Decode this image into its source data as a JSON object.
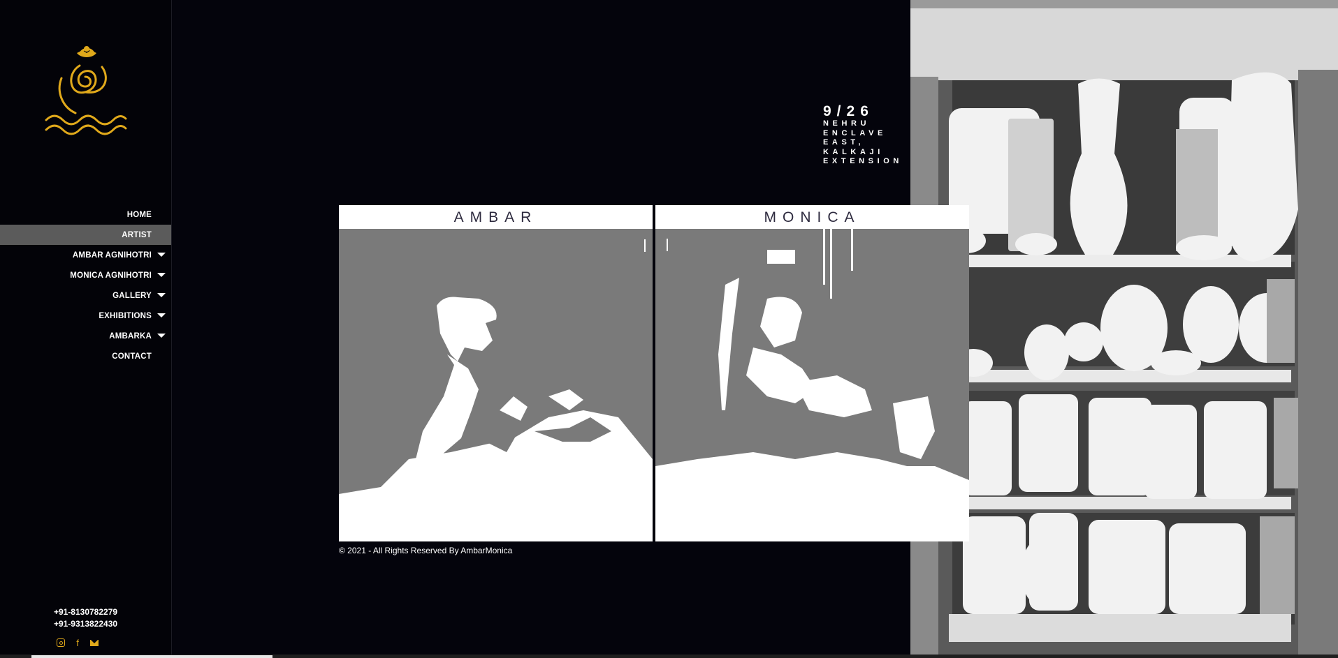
{
  "nav": {
    "items": [
      {
        "label": "HOME",
        "active": false,
        "caret": false
      },
      {
        "label": "ARTIST",
        "active": true,
        "caret": false
      },
      {
        "label": "AMBAR AGNIHOTRI",
        "active": false,
        "caret": true
      },
      {
        "label": "MONICA AGNIHOTRI",
        "active": false,
        "caret": true
      },
      {
        "label": "GALLERY",
        "active": false,
        "caret": true
      },
      {
        "label": "EXHIBITIONS",
        "active": false,
        "caret": true
      },
      {
        "label": "AMBARKA",
        "active": false,
        "caret": true
      },
      {
        "label": "CONTACT",
        "active": false,
        "caret": false
      }
    ]
  },
  "contact": {
    "phone1": "+91-8130782279",
    "phone2": "+91-9313822430",
    "social_icons": [
      "instagram-icon",
      "facebook-icon",
      "mail-icon"
    ]
  },
  "address": {
    "number": "9/26",
    "line1": "NEHRU",
    "line2": "ENCLAVE",
    "line3": "EAST,",
    "line4": "KALKAJI",
    "line5": "EXTENSION"
  },
  "artists": {
    "left_title": "AMBAR",
    "right_title": "MONICA"
  },
  "footer": {
    "copyright": "© 2021 - All Rights Reserved By AmbarMonica"
  },
  "colors": {
    "background": "#04040c",
    "accent": "#e0a91b",
    "active_nav": "#5b5b5b",
    "title_text": "#2e2b3f"
  }
}
